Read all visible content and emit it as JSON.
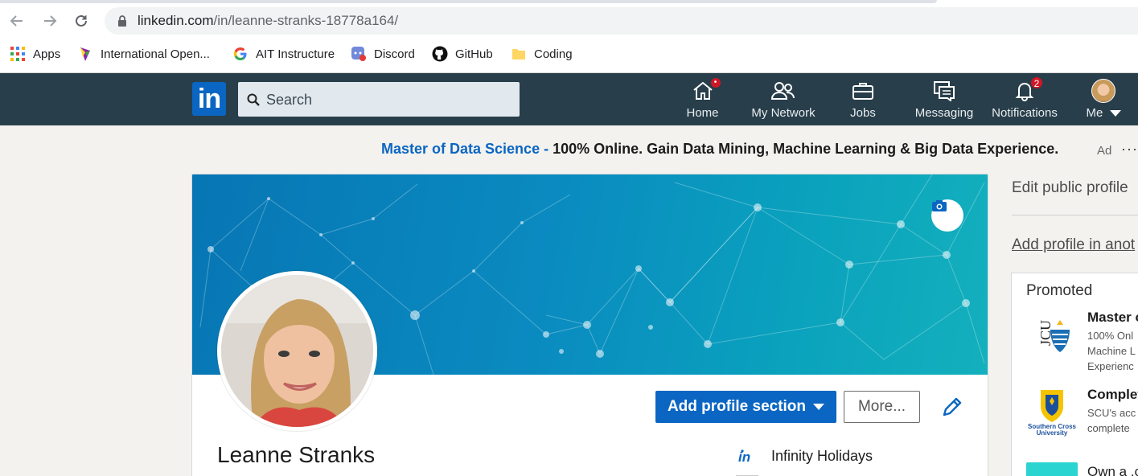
{
  "browser": {
    "url_domain": "linkedin.com",
    "url_path": "/in/leanne-stranks-18778a164/",
    "bookmarks": [
      {
        "label": "Apps",
        "icon": "apps-grid-icon"
      },
      {
        "label": "International Open...",
        "icon": "feather-icon"
      },
      {
        "label": "AIT Instructure",
        "icon": "google-icon"
      },
      {
        "label": "Discord",
        "icon": "discord-icon"
      },
      {
        "label": "GitHub",
        "icon": "github-icon"
      },
      {
        "label": "Coding",
        "icon": "folder-icon"
      }
    ]
  },
  "linkedin_nav": {
    "logo": "in",
    "search_placeholder": "Search",
    "items": [
      {
        "label": "Home",
        "icon": "home-icon",
        "badge": "•"
      },
      {
        "label": "My Network",
        "icon": "network-icon",
        "badge": ""
      },
      {
        "label": "Jobs",
        "icon": "briefcase-icon",
        "badge": ""
      },
      {
        "label": "Messaging",
        "icon": "messaging-icon",
        "badge": ""
      },
      {
        "label": "Notifications",
        "icon": "bell-icon",
        "badge": "2"
      },
      {
        "label": "Me",
        "icon": "avatar-icon",
        "badge": ""
      }
    ]
  },
  "ad": {
    "link_text": "Master of Data Science -",
    "text": " 100% Online. Gain Data Mining, Machine Learning & Big Data Experience.",
    "tag": "Ad",
    "more": "···"
  },
  "profile": {
    "name": "Leanne Stranks",
    "add_section_label": "Add profile section",
    "more_label": "More...",
    "employer": "Infinity Holidays"
  },
  "right_rail": {
    "edit_public_profile": "Edit public profile",
    "add_profile_other_language": "Add profile in anot",
    "promoted_title": "Promoted",
    "promos": [
      {
        "headline": "Master o",
        "body": [
          "100% Onl",
          "Machine L",
          "Experienc"
        ],
        "logo": "JCU"
      },
      {
        "headline": "Complet",
        "body": [
          "SCU's acc",
          "complete"
        ],
        "logo": "Southern Cross University"
      },
      {
        "headline": "Own a .c",
        "body": [],
        "logo": ""
      }
    ]
  },
  "colors": {
    "linkedin_blue": "#0a66c2",
    "nav_bg": "#283e4a",
    "badge_red": "#cf1727"
  }
}
